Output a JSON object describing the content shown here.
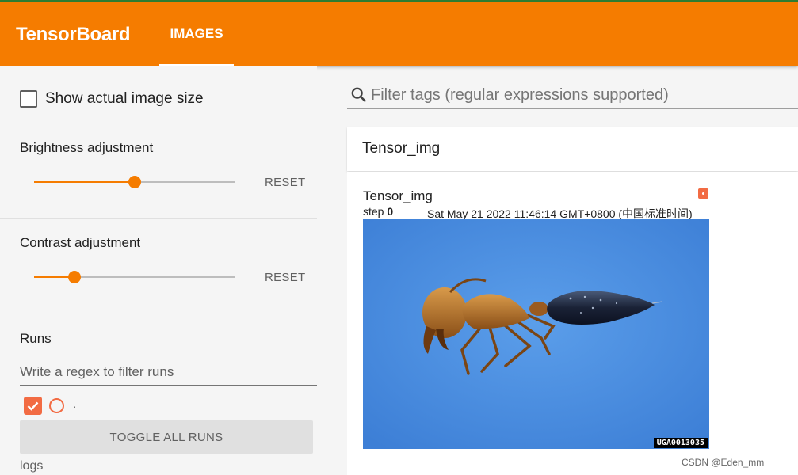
{
  "app": {
    "title": "TensorBoard",
    "active_tab": "IMAGES"
  },
  "sidebar": {
    "show_actual_size_label": "Show actual image size",
    "brightness": {
      "label": "Brightness adjustment",
      "value": 0.5,
      "reset_label": "RESET"
    },
    "contrast": {
      "label": "Contrast adjustment",
      "value": 0.2,
      "reset_label": "RESET"
    },
    "runs": {
      "title": "Runs",
      "filter_placeholder": "Write a regex to filter runs",
      "items": [
        {
          "name": ".",
          "checked": true,
          "color": "#f26b43"
        }
      ],
      "toggle_all_label": "TOGGLE ALL RUNS",
      "logdir": "logs"
    }
  },
  "main": {
    "search_placeholder": "Filter tags (regular expressions supported)",
    "group_title": "Tensor_img",
    "card": {
      "title": "Tensor_img",
      "step_label": "step",
      "step_value": "0",
      "timestamp": "Sat May 21 2022 11:46:14 GMT+0800 (中国标准时间)",
      "image_id": "UGA0013035",
      "run_color": "#f26b43"
    }
  },
  "watermark": "CSDN @Eden_mm",
  "colors": {
    "header": "#f57c00",
    "accent": "#f57c00",
    "run": "#f26b43"
  }
}
